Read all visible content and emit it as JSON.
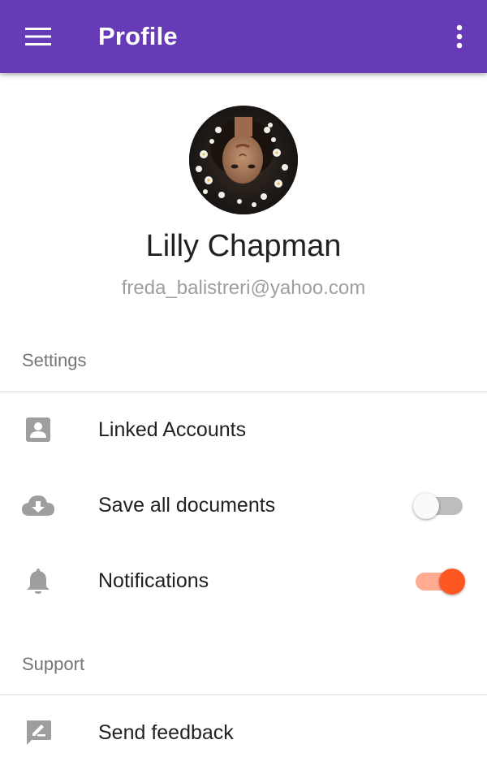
{
  "appbar": {
    "title": "Profile",
    "color": "#673ab7",
    "menu_icon": "menu-icon",
    "more_icon": "more-vert-icon"
  },
  "profile": {
    "name": "Lilly Chapman",
    "email": "freda_balistreri@yahoo.com",
    "avatar": "avatar-photo"
  },
  "settings": {
    "header": "Settings",
    "items": [
      {
        "label": "Linked Accounts",
        "icon": "account-box-icon"
      },
      {
        "label": "Save all documents",
        "icon": "cloud-download-icon",
        "toggle": false
      },
      {
        "label": "Notifications",
        "icon": "bell-icon",
        "toggle": true
      }
    ]
  },
  "support": {
    "header": "Support",
    "items": [
      {
        "label": "Send feedback",
        "icon": "feedback-icon"
      }
    ]
  },
  "colors": {
    "accent": "#ff5722",
    "accent_track": "#ffab91",
    "icon_gray": "#9e9e9e"
  }
}
